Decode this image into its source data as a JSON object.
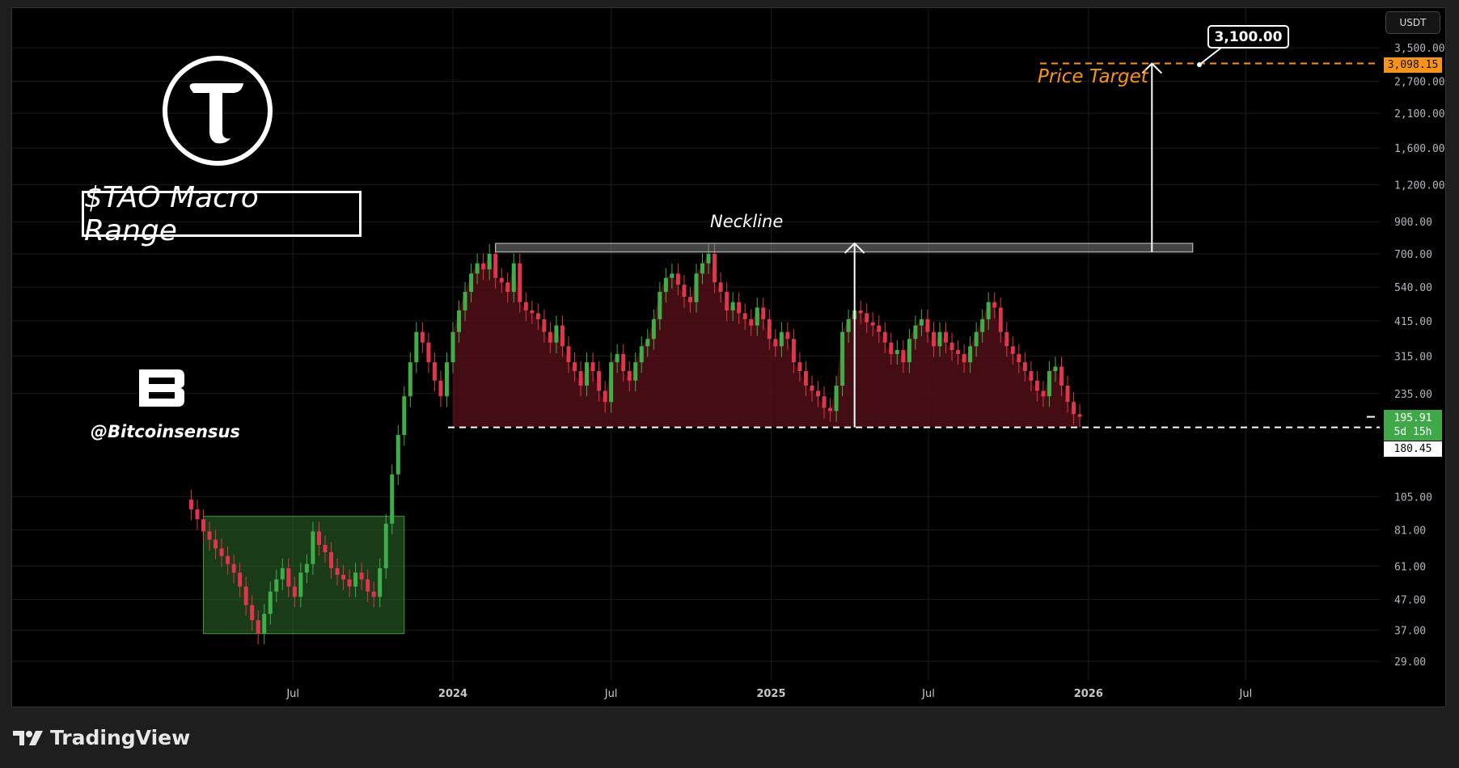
{
  "header": {
    "currency_button": "USDT"
  },
  "annotations": {
    "title": "$TAO Macro Range",
    "handle": "@Bitcoinsensus",
    "neckline_label": "Neckline",
    "price_target_label": "Price Target",
    "callout_value": "3,100.00"
  },
  "price_tags": {
    "target": "3,098.15",
    "last_price": "195.91",
    "countdown": "5d 15h",
    "support": "180.45"
  },
  "footer": {
    "brand": "TradingView"
  },
  "colors": {
    "up": "#3fae49",
    "down": "#e0354a",
    "target": "#f7931a",
    "area": "#5a1219",
    "box": "#2e6b2a"
  },
  "chart_data": {
    "type": "candlestick",
    "interval": "1W",
    "symbol": "TAO/USDT",
    "scale": "log",
    "start_date": "2023-03-06",
    "close": [
      95,
      88,
      80,
      75,
      70,
      66,
      62,
      58,
      52,
      45,
      40,
      36,
      42,
      50,
      55,
      60,
      52,
      48,
      58,
      62,
      80,
      72,
      68,
      60,
      57,
      55,
      52,
      58,
      55,
      50,
      48,
      60,
      85,
      125,
      170,
      230,
      300,
      380,
      350,
      300,
      260,
      230,
      300,
      380,
      450,
      520,
      600,
      650,
      620,
      700,
      580,
      560,
      520,
      650,
      480,
      450,
      440,
      420,
      380,
      350,
      400,
      340,
      300,
      280,
      250,
      300,
      280,
      240,
      220,
      300,
      320,
      280,
      260,
      300,
      340,
      360,
      420,
      520,
      580,
      600,
      550,
      500,
      480,
      600,
      650,
      700,
      560,
      520,
      450,
      480,
      440,
      420,
      400,
      460,
      420,
      360,
      340,
      380,
      360,
      300,
      280,
      250,
      240,
      230,
      210,
      205,
      250,
      380,
      420,
      450,
      440,
      410,
      400,
      380,
      350,
      320,
      330,
      300,
      360,
      400,
      420,
      380,
      340,
      380,
      350,
      330,
      320,
      300,
      340,
      380,
      420,
      480,
      460,
      380,
      340,
      320,
      300,
      280,
      260,
      240,
      230,
      280,
      290,
      250,
      220,
      200,
      195.91
    ],
    "y_ticks": [
      "3,500.00",
      "2,700.00",
      "2,100.00",
      "1,600.00",
      "1,200.00",
      "900.00",
      "700.00",
      "540.00",
      "415.00",
      "315.00",
      "235.00",
      "105.00",
      "81.00",
      "61.00",
      "47.00",
      "37.00",
      "29.00"
    ],
    "y_tick_values": [
      3500,
      2700,
      2100,
      1600,
      1200,
      900,
      700,
      540,
      415,
      315,
      235,
      105,
      81,
      61,
      47,
      37,
      29
    ],
    "x_ticks": [
      {
        "label": "Jul",
        "date": "2023-07-01",
        "bold": false
      },
      {
        "label": "2024",
        "date": "2024-01-01",
        "bold": true
      },
      {
        "label": "Jul",
        "date": "2024-07-01",
        "bold": false
      },
      {
        "label": "2025",
        "date": "2025-01-01",
        "bold": true
      },
      {
        "label": "Jul",
        "date": "2025-07-01",
        "bold": false
      },
      {
        "label": "2026",
        "date": "2026-01-01",
        "bold": true
      },
      {
        "label": "Jul",
        "date": "2026-07-01",
        "bold": false
      }
    ],
    "levels": {
      "support": 180.45,
      "target": 3098.15,
      "neckline_low": 710,
      "neckline_high": 760
    },
    "accumulation_box": {
      "start": "2023-03-20",
      "end": "2023-11-06",
      "low": 36,
      "high": 90
    },
    "neckline_zone": {
      "start": "2024-02-19",
      "end": "2026-05-01"
    },
    "measured_moves": [
      {
        "date": "2025-04-07",
        "from": 180.45,
        "to": 760
      },
      {
        "date": "2026-03-15",
        "from": 710,
        "to": 3098.15
      }
    ],
    "area_start": "2024-01-01"
  }
}
